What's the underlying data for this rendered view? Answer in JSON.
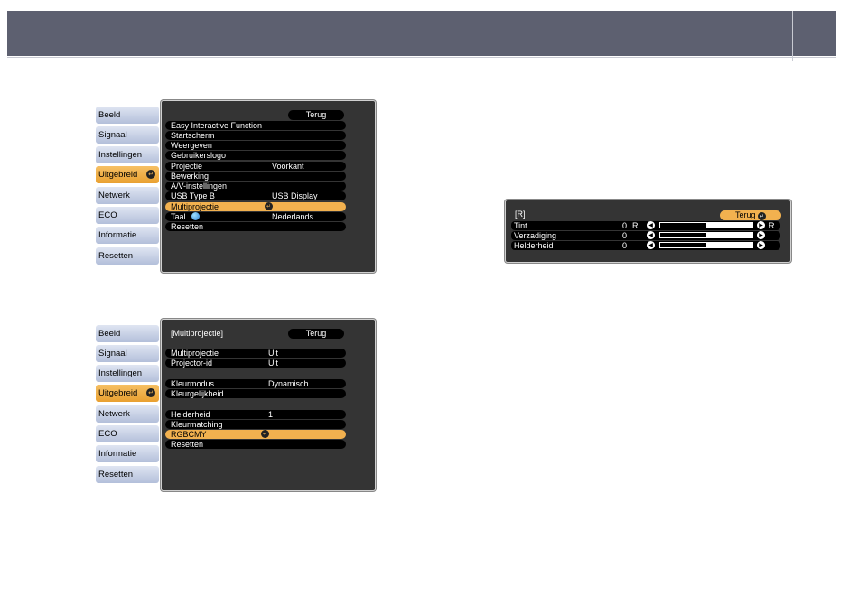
{
  "menu1": {
    "tabs": [
      {
        "label": "Beeld",
        "active": false
      },
      {
        "label": "Signaal",
        "active": false
      },
      {
        "label": "Instellingen",
        "active": false
      },
      {
        "label": "Uitgebreid",
        "active": true
      },
      {
        "label": "Netwerk",
        "active": false
      },
      {
        "label": "ECO",
        "active": false
      },
      {
        "label": "Informatie",
        "active": false
      },
      {
        "label": "Resetten",
        "active": false
      }
    ],
    "back_label": "Terug",
    "items": [
      {
        "label": "Easy Interactive Function",
        "value": ""
      },
      {
        "label": "Startscherm",
        "value": ""
      },
      {
        "label": "Weergeven",
        "value": ""
      },
      {
        "label": "Gebruikerslogo",
        "value": ""
      },
      {
        "label": "Projectie",
        "value": "Voorkant"
      },
      {
        "label": "Bewerking",
        "value": ""
      },
      {
        "label": "A/V-instellingen",
        "value": ""
      },
      {
        "label": "USB Type B",
        "value": "USB Display"
      },
      {
        "label": "Multiprojectie",
        "value": "",
        "selected": true
      },
      {
        "label": "Taal",
        "value": "Nederlands"
      },
      {
        "label": "Resetten",
        "value": ""
      }
    ]
  },
  "menu2": {
    "tabs": [
      {
        "label": "Beeld"
      },
      {
        "label": "Signaal"
      },
      {
        "label": "Instellingen"
      },
      {
        "label": "Uitgebreid"
      },
      {
        "label": "Netwerk"
      },
      {
        "label": "ECO"
      },
      {
        "label": "Informatie"
      },
      {
        "label": "Resetten"
      }
    ],
    "title": "[Multiprojectie]",
    "back_label": "Terug",
    "items": [
      {
        "label": "Multiprojectie",
        "value": "Uit"
      },
      {
        "label": "Projector-id",
        "value": "Uit"
      },
      {
        "label": "Kleurmodus",
        "value": "Dynamisch"
      },
      {
        "label": "Kleurgelijkheid",
        "value": ""
      },
      {
        "label": "Helderheid",
        "value": "1"
      },
      {
        "label": "Kleurmatching",
        "value": ""
      },
      {
        "label": "RGBCMY",
        "value": "",
        "selected": true
      },
      {
        "label": "Resetten",
        "value": ""
      }
    ]
  },
  "adjust": {
    "title": "[R]",
    "back_label": "Terug",
    "rows": [
      {
        "label": "Tint",
        "value": "0",
        "left_letter": "R",
        "right_letter": "R",
        "level": 0.5
      },
      {
        "label": "Verzadiging",
        "value": "0",
        "left_letter": "",
        "right_letter": "",
        "level": 0.5
      },
      {
        "label": "Helderheid",
        "value": "0",
        "left_letter": "",
        "right_letter": "",
        "level": 0.5
      }
    ]
  },
  "colors": {
    "header": "#5d6070",
    "accent": "#f2b14f",
    "panel": "#343434"
  },
  "icons": {
    "enter": "enter-icon",
    "globe": "globe-icon",
    "left": "arrow-left-icon",
    "right": "arrow-right-icon"
  }
}
